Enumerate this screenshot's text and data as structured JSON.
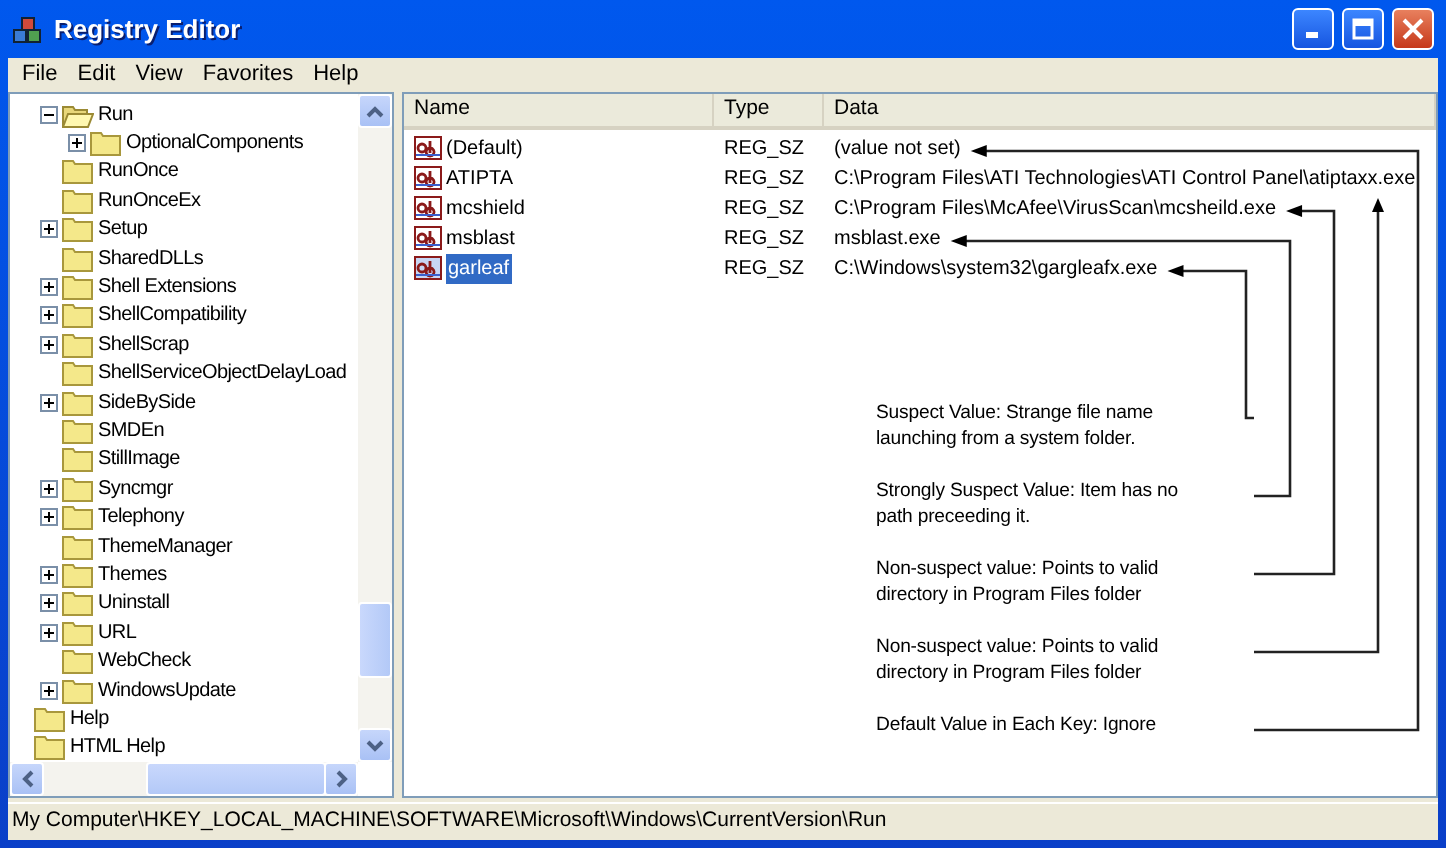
{
  "window": {
    "title": "Registry Editor"
  },
  "menu": [
    "File",
    "Edit",
    "View",
    "Favorites",
    "Help"
  ],
  "tree": {
    "items": [
      {
        "children": [
          {
            "label": "Run",
            "expandable": true,
            "expanded": true,
            "children": [
              {
                "label": "OptionalComponents",
                "expandable": true,
                "expanded": false
              }
            ]
          },
          {
            "label": "RunOnce",
            "expandable": false
          },
          {
            "label": "RunOnceEx",
            "expandable": false
          },
          {
            "label": "Setup",
            "expandable": true,
            "expanded": false
          },
          {
            "label": "SharedDLLs",
            "expandable": false
          },
          {
            "label": "Shell Extensions",
            "expandable": true,
            "expanded": false
          },
          {
            "label": "ShellCompatibility",
            "expandable": true,
            "expanded": false
          },
          {
            "label": "ShellScrap",
            "expandable": true,
            "expanded": false
          },
          {
            "label": "ShellServiceObjectDelayLoad",
            "expandable": false
          },
          {
            "label": "SideBySide",
            "expandable": true,
            "expanded": false
          },
          {
            "label": "SMDEn",
            "expandable": false
          },
          {
            "label": "StillImage",
            "expandable": false
          },
          {
            "label": "Syncmgr",
            "expandable": true,
            "expanded": false
          },
          {
            "label": "Telephony",
            "expandable": true,
            "expanded": false
          },
          {
            "label": "ThemeManager",
            "expandable": false
          },
          {
            "label": "Themes",
            "expandable": true,
            "expanded": false
          },
          {
            "label": "Uninstall",
            "expandable": true,
            "expanded": false
          },
          {
            "label": "URL",
            "expandable": true,
            "expanded": false
          },
          {
            "label": "WebCheck",
            "expandable": false
          },
          {
            "label": "WindowsUpdate",
            "expandable": true,
            "expanded": false
          }
        ]
      },
      {
        "label": "Help",
        "expandable": false
      },
      {
        "label": "HTML Help",
        "expandable": false
      }
    ]
  },
  "list": {
    "columns": [
      "Name",
      "Type",
      "Data"
    ],
    "rows": [
      {
        "name": "(Default)",
        "type": "REG_SZ",
        "data": "(value not set)",
        "selected": false
      },
      {
        "name": "ATIPTA",
        "type": "REG_SZ",
        "data": "C:\\Program Files\\ATI Technologies\\ATI Control Panel\\atiptaxx.exe",
        "selected": false
      },
      {
        "name": "mcshield",
        "type": "REG_SZ",
        "data": "C:\\Program Files\\McAfee\\VirusScan\\mcsheild.exe",
        "selected": false
      },
      {
        "name": "msblast",
        "type": "REG_SZ",
        "data": "msblast.exe",
        "selected": false
      },
      {
        "name": "garleaf",
        "type": "REG_SZ",
        "data": "C:\\Windows\\system32\\gargleafx.exe",
        "selected": true
      }
    ],
    "callouts": [
      "Suspect Value: Strange file name launching from a system folder.",
      "Strongly Suspect Value:  Item has no path preceeding it.",
      "Non-suspect value: Points to valid directory in Program Files folder",
      "Non-suspect value: Points to valid directory in Program Files folder",
      "Default Value in Each Key:  Ignore"
    ]
  },
  "status_bar": "My Computer\\HKEY_LOCAL_MACHINE\\SOFTWARE\\Microsoft\\Windows\\CurrentVersion\\Run"
}
